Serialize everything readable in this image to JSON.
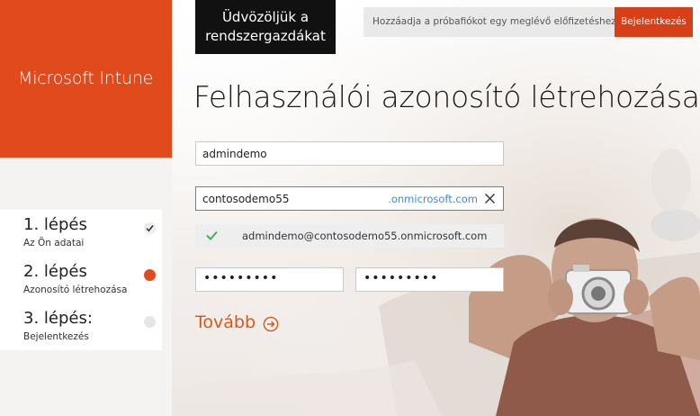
{
  "brand": {
    "name": "Microsoft Intune",
    "color": "#e04a1c"
  },
  "steps": [
    {
      "title": "1. lépés",
      "subtitle": "Az Ön adatai",
      "state": "done",
      "icon": "check-icon"
    },
    {
      "title": "2. lépés",
      "subtitle": "Azonosító létrehozása",
      "state": "active",
      "icon": "active-dot-icon"
    },
    {
      "title": "3. lépés:",
      "subtitle": "Bejelentkezés",
      "state": "pending",
      "icon": "pending-dot-icon"
    }
  ],
  "welcome": {
    "line1": "Üdvözöljük a",
    "line2": "rendszergazdákat"
  },
  "topbar": {
    "prompt": "Hozzáadja a próbafiókot egy meglévő előfizetéshez?",
    "signin_label": "Bejelentkezés"
  },
  "page_title": "Felhasználói azonosító létrehozása",
  "form": {
    "username_value": "admindemo",
    "domain_value": "contosodemo55",
    "domain_suffix": ".onmicrosoft.com",
    "availability": "admindemo@contosodemo55.onmicrosoft.com",
    "password_value": "•••••••••",
    "confirm_password_value": "•••••••••"
  },
  "next_label": "Tovább",
  "colors": {
    "accent": "#e04a1c",
    "link_blue": "#3a8bd8",
    "success": "#3ab54a"
  }
}
